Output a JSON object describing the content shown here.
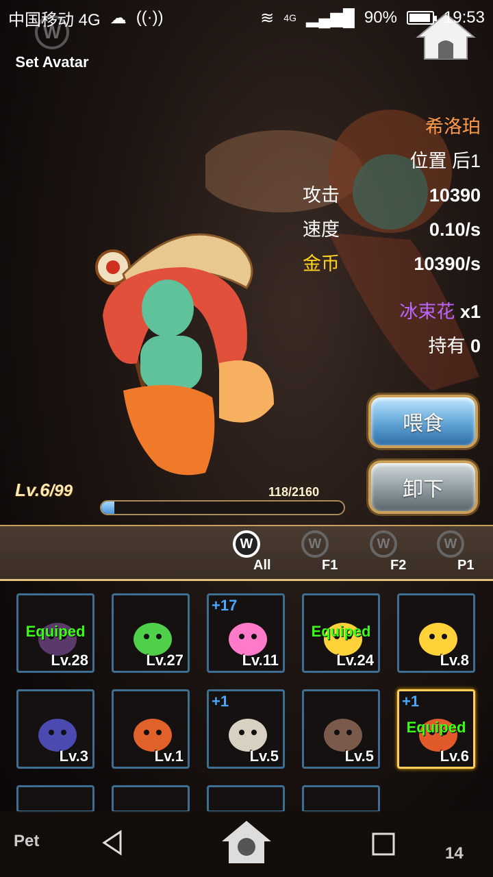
{
  "status_bar": {
    "carrier": "中国移动 4G",
    "network": "4G",
    "battery": "90%",
    "time": "19:53"
  },
  "avatar": {
    "label": "Set Avatar",
    "icon": "w-emblem-icon",
    "icon_glyph": "W"
  },
  "pet": {
    "name": "希洛珀",
    "position_label": "位置",
    "position_value": "后1",
    "attack_label": "攻击",
    "attack_value": "10390",
    "speed_label": "速度",
    "speed_value": "0.10/s",
    "gold_label": "金币",
    "gold_value": "10390/s",
    "item_name": "冰束花",
    "item_qty": "x1",
    "hold_label": "持有",
    "hold_value": "0",
    "level": "Lv.6",
    "level_max": "/99",
    "exp_text": "118/2160",
    "exp_current": 118,
    "exp_max": 2160
  },
  "buttons": {
    "feed": "喂食",
    "unload": "卸下"
  },
  "tabs": [
    {
      "label": "All",
      "icon_glyph": "W",
      "active": true
    },
    {
      "label": "F1",
      "icon_glyph": "W",
      "active": false
    },
    {
      "label": "F2",
      "icon_glyph": "W",
      "active": false
    },
    {
      "label": "P1",
      "icon_glyph": "W",
      "active": false
    }
  ],
  "pets": [
    {
      "level": "Lv.28",
      "plus": "",
      "equipped": "Equiped",
      "color": "#5a3a6a"
    },
    {
      "level": "Lv.27",
      "plus": "",
      "equipped": "",
      "color": "#4fcf4a"
    },
    {
      "level": "Lv.11",
      "plus": "+17",
      "equipped": "",
      "color": "#ff7ac8"
    },
    {
      "level": "Lv.24",
      "plus": "",
      "equipped": "Equiped",
      "color": "#ffd23a"
    },
    {
      "level": "Lv.8",
      "plus": "",
      "equipped": "",
      "color": "#ffd23a"
    },
    {
      "level": "Lv.3",
      "plus": "",
      "equipped": "",
      "color": "#4a4ab0"
    },
    {
      "level": "Lv.1",
      "plus": "",
      "equipped": "",
      "color": "#e0622a"
    },
    {
      "level": "Lv.5",
      "plus": "+1",
      "equipped": "",
      "color": "#d8d0c0"
    },
    {
      "level": "Lv.5",
      "plus": "",
      "equipped": "",
      "color": "#7a5a4a"
    },
    {
      "level": "Lv.6",
      "plus": "+1",
      "equipped": "Equiped",
      "color": "#e05a2a",
      "selected": true
    }
  ],
  "bottom": {
    "pet_label": "Pet",
    "count": "14"
  }
}
